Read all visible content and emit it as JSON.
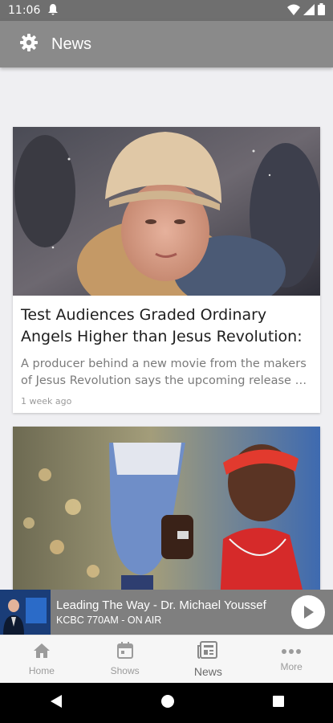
{
  "status_bar": {
    "time": "11:06"
  },
  "app_bar": {
    "title": "News"
  },
  "articles": [
    {
      "headline_line1": "Test Audiences Graded Ordinary",
      "headline_line2": "Angels Higher than Jesus Revolution:",
      "summary_line1": "A producer behind a new movie from the makers",
      "summary_line2": "of Jesus Revolution says the upcoming release wi...",
      "time": "1 week ago"
    }
  ],
  "player": {
    "show": "Leading The Way - Dr. Michael Youssef",
    "station": "KCBC 770AM - ON AIR"
  },
  "tabs": [
    {
      "label": "Home",
      "icon": "home-icon"
    },
    {
      "label": "Shows",
      "icon": "calendar-icon"
    },
    {
      "label": "News",
      "icon": "newspaper-icon"
    },
    {
      "label": "More",
      "icon": "more-icon"
    }
  ]
}
